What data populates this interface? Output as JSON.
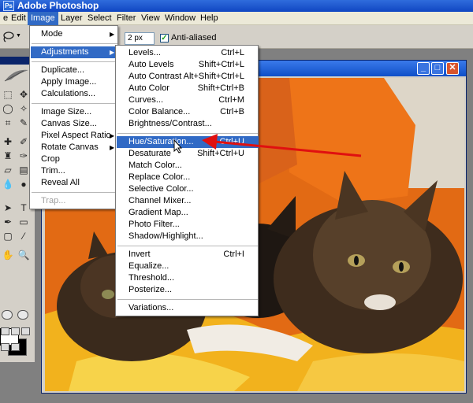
{
  "app": {
    "title": "Adobe Photoshop",
    "icon_name": "photoshop-icon",
    "title_bar_color": "#1452c8"
  },
  "menubar": {
    "items": [
      "e",
      "Edit",
      "Image",
      "Layer",
      "Select",
      "Filter",
      "View",
      "Window",
      "Help"
    ],
    "active": "Image"
  },
  "options": {
    "feather_value": "2 px",
    "anti_aliased_label": "Anti-aliased",
    "anti_aliased_checked": true
  },
  "image_menu": {
    "items": [
      {
        "label": "Mode",
        "submenu": true
      },
      {
        "label": "Adjustments",
        "submenu": true,
        "highlighted": true
      },
      {
        "label": "Duplicate..."
      },
      {
        "label": "Apply Image..."
      },
      {
        "label": "Calculations..."
      },
      {
        "label": "Image Size..."
      },
      {
        "label": "Canvas Size..."
      },
      {
        "label": "Pixel Aspect Ratio",
        "submenu": true
      },
      {
        "label": "Rotate Canvas",
        "submenu": true
      },
      {
        "label": "Crop"
      },
      {
        "label": "Trim..."
      },
      {
        "label": "Reveal All"
      },
      {
        "label": "Trap...",
        "disabled": true
      }
    ]
  },
  "adjustments_menu": {
    "items": [
      {
        "label": "Levels...",
        "shortcut": "Ctrl+L"
      },
      {
        "label": "Auto Levels",
        "shortcut": "Shift+Ctrl+L"
      },
      {
        "label": "Auto Contrast",
        "shortcut": "Alt+Shift+Ctrl+L"
      },
      {
        "label": "Auto Color",
        "shortcut": "Shift+Ctrl+B"
      },
      {
        "label": "Curves...",
        "shortcut": "Ctrl+M"
      },
      {
        "label": "Color Balance...",
        "shortcut": "Ctrl+B"
      },
      {
        "label": "Brightness/Contrast...",
        "shortcut": ""
      },
      {
        "label": "Hue/Saturation...",
        "shortcut": "Ctrl+U",
        "highlighted": true
      },
      {
        "label": "Desaturate",
        "shortcut": "Shift+Ctrl+U"
      },
      {
        "label": "Match Color...",
        "shortcut": ""
      },
      {
        "label": "Replace Color...",
        "shortcut": ""
      },
      {
        "label": "Selective Color...",
        "shortcut": ""
      },
      {
        "label": "Channel Mixer...",
        "shortcut": ""
      },
      {
        "label": "Gradient Map...",
        "shortcut": ""
      },
      {
        "label": "Photo Filter...",
        "shortcut": ""
      },
      {
        "label": "Shadow/Highlight...",
        "shortcut": ""
      },
      {
        "label": "Invert",
        "shortcut": "Ctrl+I"
      },
      {
        "label": "Equalize...",
        "shortcut": ""
      },
      {
        "label": "Threshold...",
        "shortcut": ""
      },
      {
        "label": "Posterize...",
        "shortcut": ""
      },
      {
        "label": "Variations...",
        "shortcut": ""
      }
    ]
  },
  "colors": {
    "highlight": "#316ac5",
    "annotation_arrow": "#e01010",
    "menu_bg": "#ffffff",
    "chrome": "#d4d0c8"
  },
  "annotation": {
    "type": "red arrow pointing to Hue/Saturation..."
  },
  "document": {
    "content": "photo of three tortoiseshell cats on orange and yellow cushions"
  }
}
